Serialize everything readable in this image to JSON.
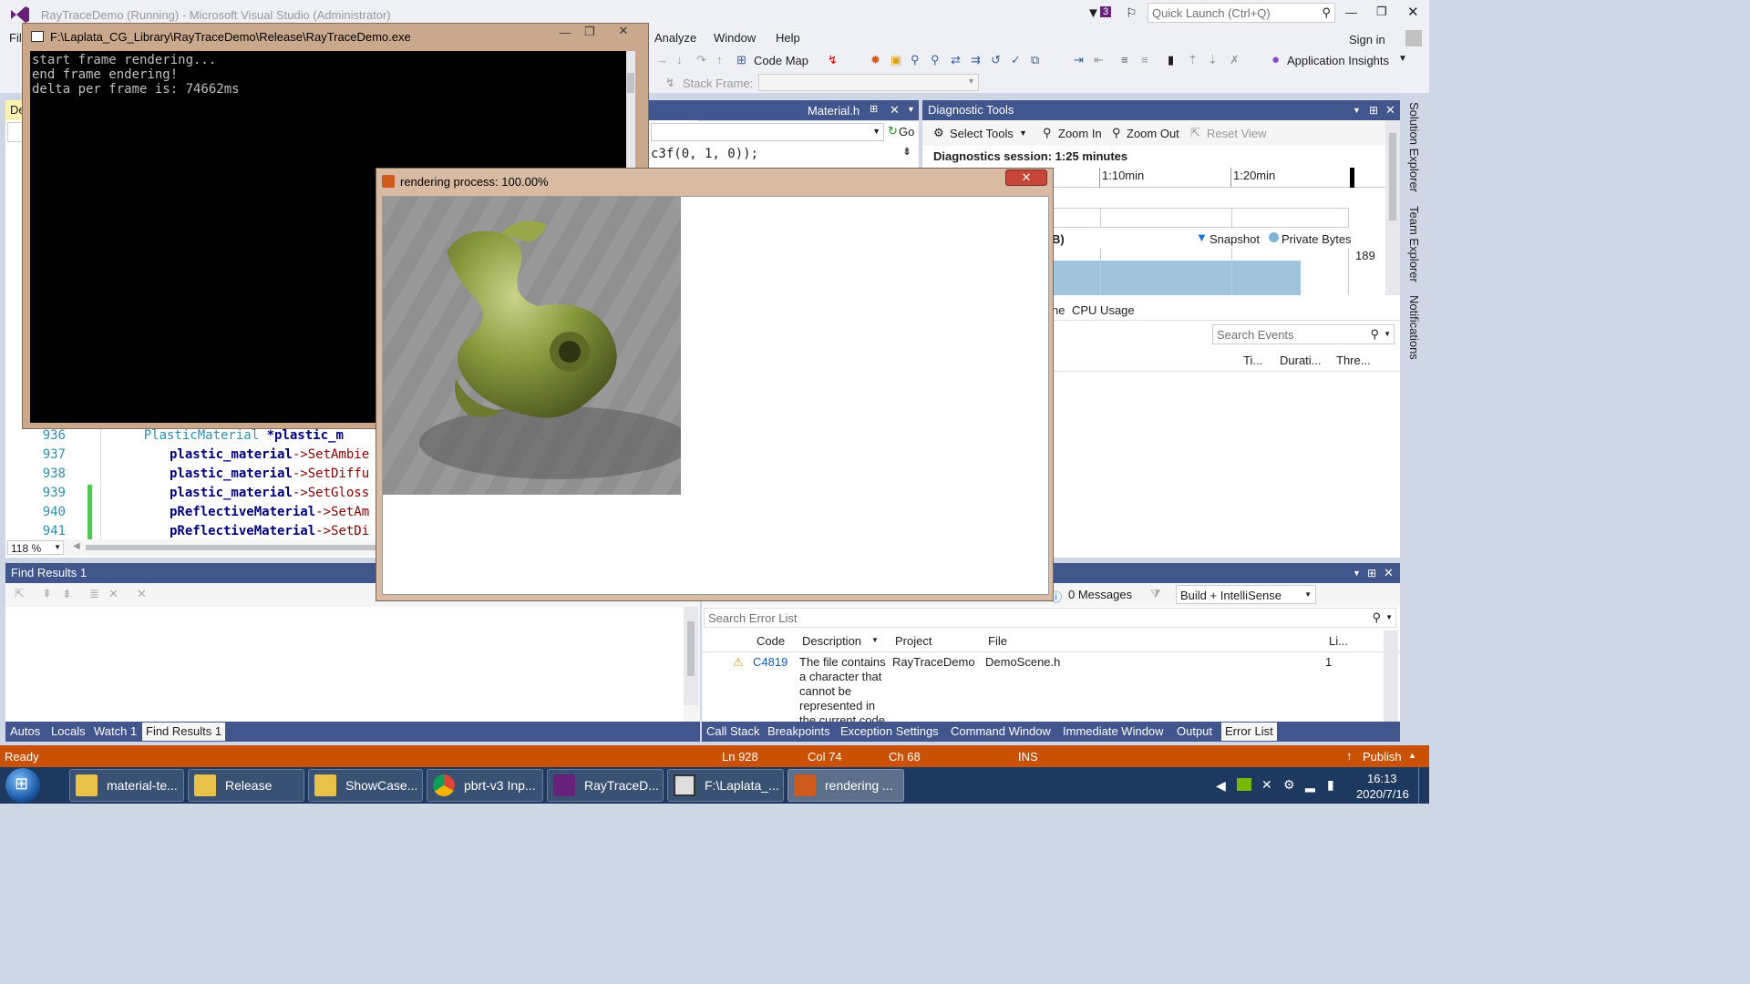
{
  "vs": {
    "title": "RayTraceDemo (Running) - Microsoft Visual Studio (Administrator)",
    "notif_count": "3",
    "quick_launch_placeholder": "Quick Launch (Ctrl+Q)",
    "sign_in": "Sign in",
    "menus": [
      "File",
      "Analyze",
      "Window",
      "Help"
    ],
    "code_map": "Code Map",
    "app_insights": "Application Insights",
    "stack_frame_label": "Stack Frame:"
  },
  "console": {
    "title": "F:\\Laplata_CG_Library\\RayTraceDemo\\Release\\RayTraceDemo.exe",
    "lines": "start frame rendering...\nend frame endering!\ndelta per frame is: 74662ms"
  },
  "render_window": {
    "title": "rendering process: 100.00%"
  },
  "editor": {
    "tab_title": "Material.h",
    "go_label": "Go",
    "fragment_line": "c3f(0, 1, 0));",
    "zoom": "118 %",
    "lines": [
      {
        "num": "936",
        "type": "PlasticMaterial",
        "rest": " *plastic_m",
        "var": ""
      },
      {
        "num": "937",
        "var": "plastic_material",
        "call": "->SetAmbie"
      },
      {
        "num": "938",
        "var": "plastic_material",
        "call": "->SetDiffu"
      },
      {
        "num": "939",
        "var": "plastic_material",
        "call": "->SetGloss"
      },
      {
        "num": "940",
        "var": "pReflectiveMaterial",
        "call": "->SetAm"
      },
      {
        "num": "941",
        "var": "pReflectiveMaterial",
        "call": "->SetDi"
      }
    ]
  },
  "diagnostics": {
    "title": "Diagnostic Tools",
    "select_tools": "Select Tools",
    "zoom_in": "Zoom In",
    "zoom_out": "Zoom Out",
    "reset_view": "Reset View",
    "session": "Diagnostics session: 1:25 minutes",
    "ticks": [
      "1:10min",
      "1:20min"
    ],
    "mem_suffix": "B)",
    "snapshot": "Snapshot",
    "private_bytes": "Private Bytes",
    "mem_value": "189",
    "tab_fragment": "ne",
    "cpu_tab": "CPU Usage",
    "search_events_placeholder": "Search Events",
    "cols": [
      "Ti...",
      "Durati...",
      "Thre..."
    ]
  },
  "find_results": {
    "title": "Find Results 1"
  },
  "bottom_tabs_left": [
    "Autos",
    "Locals",
    "Watch 1",
    "Find Results 1"
  ],
  "error_list": {
    "messages": "0 Messages",
    "filter": "Build + IntelliSense",
    "search_placeholder": "Search Error List",
    "headers": [
      "Code",
      "Description",
      "Project",
      "File",
      "Li..."
    ],
    "rows": [
      {
        "code": "C4819",
        "description": "The file contains a character that cannot be represented in the current code",
        "project": "RayTraceDemo",
        "file": "DemoScene.h",
        "line": "1"
      }
    ]
  },
  "bottom_tabs_right": [
    "Call Stack",
    "Breakpoints",
    "Exception Settings",
    "Command Window",
    "Immediate Window",
    "Output",
    "Error List"
  ],
  "side_tabs": [
    "Solution Explorer",
    "Team Explorer",
    "Notifications"
  ],
  "status": {
    "ready": "Ready",
    "ln": "Ln 928",
    "col": "Col 74",
    "ch": "Ch 68",
    "ins": "INS",
    "publish": "Publish"
  },
  "taskbar": {
    "items": [
      {
        "label": "material-te...",
        "icon": "folder-icon"
      },
      {
        "label": "Release",
        "icon": "folder-icon"
      },
      {
        "label": "ShowCase...",
        "icon": "folder-icon"
      },
      {
        "label": "pbrt-v3 Inp...",
        "icon": "chrome-icon"
      },
      {
        "label": "RayTraceD...",
        "icon": "visual-studio-icon"
      },
      {
        "label": "F:\\Laplata_...",
        "icon": "console-icon"
      },
      {
        "label": "rendering ...",
        "icon": "mfc-app-icon"
      }
    ],
    "time": "16:13",
    "date": "2020/7/16"
  },
  "colors": {
    "accent": "#40568d",
    "status_bar": "#ca5100",
    "taskbar": "#1e3960",
    "link": "#1a5bbf"
  }
}
